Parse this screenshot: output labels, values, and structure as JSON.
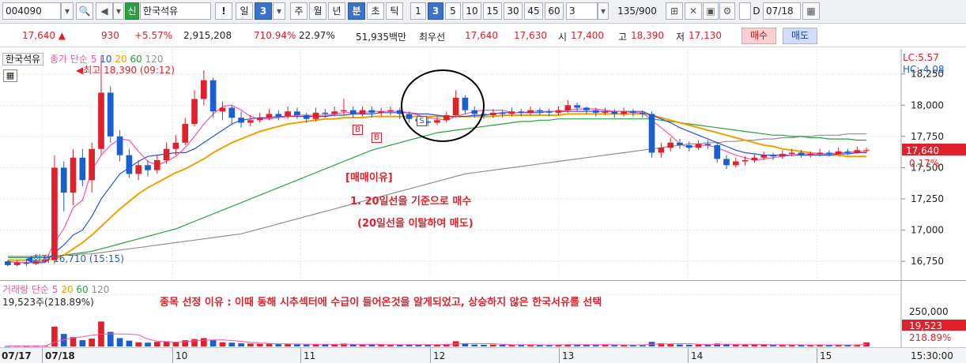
{
  "toolbar": {
    "stock_code": "004090",
    "stock_name_tag": "신",
    "stock_name": "한국석유",
    "period_day": "일",
    "period_day_count": "3",
    "period_week": "주",
    "period_month": "월",
    "period_year": "년",
    "period_minute": "분",
    "period_second": "초",
    "period_tick": "틱",
    "interval_options": [
      "1",
      "3",
      "5",
      "10",
      "15",
      "30",
      "45",
      "60"
    ],
    "selected_interval": "3",
    "interval_field": "3",
    "bar_count": "135/900",
    "date_checkbox_label": "D",
    "date_value": "07/18"
  },
  "quote": {
    "price": "17,640 ▲",
    "change": "930",
    "change_pct": "+5.57%",
    "volume": "2,915,208",
    "volume_ratio": "710.94%",
    "turnover": "22.97%",
    "trade_value": "51,935백만",
    "best_label": "최우선",
    "best_ask": "17,640",
    "best_bid": "17,630",
    "open_label": "시",
    "open": "17,400",
    "high_label": "고",
    "high": "18,390",
    "low_label": "저",
    "low": "17,130",
    "buy_button": "매수",
    "sell_button": "매도"
  },
  "price_legend": {
    "name": "한국석유",
    "ma_prefix": "종가 단순",
    "ma_periods": [
      "5",
      "10",
      "20",
      "60",
      "120"
    ],
    "high_marker": "최고 18,390 (09:12)",
    "low_marker": "최저 16,710 (15:15)"
  },
  "volume_legend": {
    "title": "거래량 단순",
    "ma_periods": [
      "5",
      "20",
      "60",
      "120"
    ],
    "current": "19,523주(218.89%)"
  },
  "right_axis": {
    "lc": "LC:5.57",
    "hc": "HC:-4.08",
    "price_ticks": [
      "18,250",
      "18,000",
      "17,750",
      "17,500",
      "17,250",
      "17,000",
      "16,750"
    ],
    "current_price": "17,640",
    "current_pct": "0.17%",
    "volume_ticks": [
      "250,000"
    ],
    "current_volume": "19,523",
    "current_volume_pct": "218.89%",
    "time_label": "15:30:00"
  },
  "x_axis": {
    "labels": [
      "07/17",
      "07/18",
      "10",
      "11",
      "12",
      "13",
      "14",
      "15"
    ]
  },
  "annotations": {
    "reason_title": "[매매이유]",
    "reason_1": "1. 20일선을 기준으로 매수",
    "reason_2": "(20일선을 이탈하여 매도)",
    "selection_reason": "종목 선정 이유 : 이때 동해 시추섹터에 수급이 들어온것을 알게되었고, 상승하지 않은 한국서유를 선택",
    "signal_b1": "B",
    "signal_b2": "B",
    "signal_s": "S"
  },
  "colors": {
    "up": "#e0202a",
    "down": "#1a5fd0",
    "ma5": "#ff4fae",
    "ma10": "#2a4fe0",
    "ma20": "#f0a000",
    "ma60": "#2aa040",
    "ma120": "#909090"
  },
  "chart_data": {
    "type": "candlestick",
    "ylim": [
      16650,
      18400
    ],
    "high": 18390,
    "low": 16710,
    "candles": [
      [
        16750,
        16720,
        16760,
        16710
      ],
      [
        16720,
        16740,
        16760,
        16710
      ],
      [
        16740,
        16730,
        16770,
        16710
      ],
      [
        16730,
        16750,
        16760,
        16720
      ],
      [
        16750,
        16760,
        16790,
        16740
      ],
      [
        16760,
        17500,
        17600,
        16730
      ],
      [
        17500,
        17300,
        17550,
        17150
      ],
      [
        17300,
        17580,
        17650,
        17200
      ],
      [
        17580,
        17400,
        17650,
        17350
      ],
      [
        17400,
        17650,
        17700,
        17300
      ],
      [
        17650,
        18100,
        18390,
        17600
      ],
      [
        18100,
        17750,
        18150,
        17700
      ],
      [
        17750,
        17600,
        17800,
        17550
      ],
      [
        17600,
        17450,
        17650,
        17420
      ],
      [
        17450,
        17520,
        17560,
        17400
      ],
      [
        17520,
        17480,
        17560,
        17430
      ],
      [
        17480,
        17560,
        17600,
        17450
      ],
      [
        17560,
        17650,
        17700,
        17530
      ],
      [
        17650,
        17700,
        17760,
        17600
      ],
      [
        17700,
        17850,
        17900,
        17680
      ],
      [
        17850,
        18050,
        18120,
        17830
      ],
      [
        18050,
        18200,
        18280,
        18000
      ],
      [
        18200,
        17950,
        18220,
        17900
      ],
      [
        17950,
        17980,
        18030,
        17880
      ],
      [
        17980,
        17900,
        18000,
        17850
      ],
      [
        17900,
        17860,
        17950,
        17820
      ],
      [
        17860,
        17880,
        17920,
        17830
      ],
      [
        17880,
        17900,
        17940,
        17860
      ],
      [
        17900,
        17930,
        17970,
        17880
      ],
      [
        17930,
        17910,
        17960,
        17880
      ],
      [
        17910,
        17950,
        17990,
        17890
      ],
      [
        17950,
        17920,
        17980,
        17890
      ],
      [
        17920,
        17890,
        17940,
        17860
      ],
      [
        17890,
        17940,
        17980,
        17870
      ],
      [
        17940,
        17930,
        17970,
        17900
      ],
      [
        17930,
        17950,
        17990,
        17910
      ],
      [
        17950,
        17960,
        18050,
        17920
      ],
      [
        17960,
        17930,
        17990,
        17900
      ],
      [
        17930,
        17960,
        17990,
        17910
      ],
      [
        17960,
        17940,
        17990,
        17900
      ],
      [
        17940,
        17950,
        17980,
        17910
      ],
      [
        17950,
        17960,
        17990,
        17920
      ],
      [
        17960,
        17930,
        17980,
        17890
      ],
      [
        17930,
        17890,
        17950,
        17860
      ],
      [
        17890,
        17870,
        17910,
        17840
      ],
      [
        17870,
        17860,
        17900,
        17830
      ],
      [
        17860,
        17880,
        17910,
        17840
      ],
      [
        17880,
        17920,
        17950,
        17860
      ],
      [
        17920,
        18060,
        18120,
        17900
      ],
      [
        18060,
        17960,
        18080,
        17930
      ],
      [
        17960,
        17930,
        17990,
        17900
      ],
      [
        17930,
        17920,
        17960,
        17890
      ],
      [
        17920,
        17940,
        17970,
        17900
      ],
      [
        17940,
        17930,
        17960,
        17900
      ],
      [
        17930,
        17950,
        17980,
        17910
      ],
      [
        17950,
        17940,
        17970,
        17910
      ],
      [
        17940,
        17960,
        17990,
        17920
      ],
      [
        17960,
        17950,
        17980,
        17920
      ],
      [
        17950,
        17940,
        17970,
        17910
      ],
      [
        17940,
        17960,
        17990,
        17920
      ],
      [
        17960,
        18000,
        18040,
        17940
      ],
      [
        18000,
        17980,
        18020,
        17950
      ],
      [
        17980,
        17960,
        17990,
        17930
      ],
      [
        17960,
        17940,
        17980,
        17910
      ],
      [
        17940,
        17950,
        17980,
        17920
      ],
      [
        17950,
        17930,
        17970,
        17900
      ],
      [
        17930,
        17950,
        17980,
        17910
      ],
      [
        17950,
        17940,
        17970,
        17910
      ],
      [
        17940,
        17930,
        17960,
        17900
      ],
      [
        17930,
        17620,
        17950,
        17580
      ],
      [
        17620,
        17660,
        17700,
        17580
      ],
      [
        17660,
        17700,
        17740,
        17630
      ],
      [
        17700,
        17680,
        17730,
        17650
      ],
      [
        17680,
        17660,
        17710,
        17630
      ],
      [
        17660,
        17690,
        17720,
        17640
      ],
      [
        17690,
        17680,
        17720,
        17650
      ],
      [
        17680,
        17570,
        17700,
        17540
      ],
      [
        17570,
        17520,
        17600,
        17490
      ],
      [
        17520,
        17550,
        17580,
        17500
      ],
      [
        17550,
        17560,
        17590,
        17520
      ],
      [
        17560,
        17580,
        17610,
        17540
      ],
      [
        17580,
        17600,
        17630,
        17560
      ],
      [
        17600,
        17590,
        17620,
        17560
      ],
      [
        17590,
        17610,
        17640,
        17570
      ],
      [
        17610,
        17620,
        17650,
        17590
      ],
      [
        17620,
        17600,
        17640,
        17580
      ],
      [
        17600,
        17610,
        17630,
        17580
      ],
      [
        17610,
        17620,
        17650,
        17590
      ],
      [
        17620,
        17610,
        17640,
        17590
      ],
      [
        17610,
        17630,
        17660,
        17600
      ],
      [
        17630,
        17620,
        17650,
        17600
      ],
      [
        17620,
        17640,
        17670,
        17610
      ],
      [
        17640,
        17640,
        17660,
        17620
      ]
    ],
    "moving_averages": [
      {
        "name": "5",
        "color": "#ff4fae",
        "values": [
          16750,
          16740,
          16740,
          16740,
          16750,
          16900,
          17010,
          17180,
          17240,
          17480,
          17600,
          17680,
          17730,
          17720,
          17630,
          17550,
          17520,
          17550,
          17590,
          17660,
          17750,
          17850,
          17930,
          17990,
          18000,
          17960,
          17910,
          17890,
          17890,
          17900,
          17910,
          17920,
          17920,
          17920,
          17920,
          17930,
          17940,
          17940,
          17940,
          17950,
          17950,
          17950,
          17950,
          17940,
          17920,
          17900,
          17890,
          17880,
          17910,
          17930,
          17950,
          17960,
          17960,
          17960,
          17940,
          17940,
          17950,
          17950,
          17950,
          17950,
          17960,
          17970,
          17970,
          17970,
          17960,
          17950,
          17950,
          17940,
          17940,
          17880,
          17820,
          17760,
          17690,
          17660,
          17680,
          17680,
          17660,
          17630,
          17600,
          17580,
          17560,
          17570,
          17580,
          17590,
          17600,
          17610,
          17610,
          17610,
          17610,
          17620,
          17620,
          17630,
          17630
        ]
      },
      {
        "name": "10",
        "color": "#2a4fe0",
        "values": [
          16750,
          16740,
          16740,
          16740,
          16740,
          16820,
          16880,
          16960,
          17000,
          17110,
          17250,
          17350,
          17450,
          17500,
          17550,
          17590,
          17600,
          17610,
          17620,
          17620,
          17650,
          17700,
          17750,
          17800,
          17850,
          17880,
          17890,
          17900,
          17900,
          17910,
          17910,
          17910,
          17910,
          17910,
          17910,
          17920,
          17920,
          17930,
          17930,
          17930,
          17940,
          17940,
          17940,
          17940,
          17930,
          17930,
          17920,
          17910,
          17910,
          17910,
          17920,
          17920,
          17930,
          17940,
          17940,
          17940,
          17940,
          17940,
          17950,
          17950,
          17950,
          17950,
          17950,
          17950,
          17950,
          17950,
          17950,
          17950,
          17950,
          17920,
          17890,
          17860,
          17820,
          17790,
          17760,
          17730,
          17700,
          17670,
          17640,
          17620,
          17610,
          17600,
          17600,
          17600,
          17600,
          17600,
          17600,
          17600,
          17600,
          17610,
          17610,
          17620,
          17620
        ]
      },
      {
        "name": "20",
        "color": "#f0a000",
        "values": [
          16760,
          16760,
          16760,
          16760,
          16760,
          16770,
          16800,
          16850,
          16900,
          16960,
          17030,
          17100,
          17170,
          17230,
          17290,
          17340,
          17380,
          17420,
          17460,
          17490,
          17530,
          17570,
          17620,
          17660,
          17700,
          17730,
          17760,
          17790,
          17810,
          17830,
          17850,
          17860,
          17870,
          17880,
          17890,
          17890,
          17900,
          17900,
          17900,
          17910,
          17910,
          17910,
          17910,
          17910,
          17910,
          17910,
          17910,
          17910,
          17910,
          17910,
          17910,
          17910,
          17910,
          17920,
          17920,
          17920,
          17920,
          17920,
          17920,
          17920,
          17930,
          17930,
          17930,
          17930,
          17930,
          17930,
          17930,
          17930,
          17930,
          17920,
          17900,
          17880,
          17860,
          17840,
          17820,
          17800,
          17780,
          17760,
          17740,
          17720,
          17700,
          17680,
          17670,
          17650,
          17640,
          17630,
          17620,
          17610,
          17600,
          17600,
          17590,
          17590,
          17590
        ]
      },
      {
        "name": "60",
        "color": "#2aa040",
        "values": [
          16780,
          16780,
          16780,
          16780,
          16780,
          16790,
          16800,
          16810,
          16820,
          16830,
          16850,
          16870,
          16890,
          16910,
          16930,
          16950,
          16970,
          16990,
          17010,
          17040,
          17070,
          17100,
          17130,
          17160,
          17190,
          17220,
          17250,
          17280,
          17310,
          17340,
          17370,
          17400,
          17430,
          17460,
          17490,
          17520,
          17550,
          17580,
          17610,
          17640,
          17660,
          17680,
          17700,
          17720,
          17740,
          17760,
          17780,
          17790,
          17800,
          17810,
          17820,
          17830,
          17840,
          17850,
          17860,
          17870,
          17870,
          17880,
          17880,
          17890,
          17890,
          17890,
          17890,
          17890,
          17890,
          17890,
          17890,
          17890,
          17890,
          17890,
          17880,
          17870,
          17860,
          17850,
          17840,
          17830,
          17820,
          17810,
          17800,
          17790,
          17780,
          17770,
          17760,
          17760,
          17750,
          17750,
          17740,
          17740,
          17730,
          17730,
          17730,
          17720,
          17720
        ]
      },
      {
        "name": "120",
        "color": "#909090",
        "values": [
          16790,
          16790,
          16790,
          16790,
          16790,
          16790,
          16800,
          16800,
          16810,
          16810,
          16820,
          16830,
          16840,
          16850,
          16860,
          16870,
          16880,
          16890,
          16900,
          16910,
          16920,
          16930,
          16940,
          16950,
          16960,
          16970,
          16990,
          17010,
          17030,
          17050,
          17070,
          17090,
          17110,
          17130,
          17150,
          17170,
          17190,
          17210,
          17230,
          17250,
          17270,
          17290,
          17310,
          17330,
          17350,
          17370,
          17390,
          17410,
          17430,
          17450,
          17460,
          17470,
          17480,
          17490,
          17500,
          17510,
          17520,
          17530,
          17540,
          17550,
          17560,
          17570,
          17580,
          17590,
          17600,
          17610,
          17620,
          17630,
          17640,
          17650,
          17660,
          17670,
          17680,
          17690,
          17690,
          17700,
          17700,
          17710,
          17710,
          17720,
          17720,
          17730,
          17730,
          17740,
          17740,
          17750,
          17750,
          17760,
          17760,
          17760,
          17770,
          17770,
          17770
        ]
      }
    ],
    "volume": [
      2000,
      2500,
      1800,
      2200,
      3000,
      95000,
      60000,
      45000,
      30000,
      38000,
      120000,
      70000,
      40000,
      28000,
      20000,
      18000,
      22000,
      25000,
      20000,
      30000,
      35000,
      40000,
      30000,
      20000,
      18000,
      15000,
      14000,
      12000,
      13000,
      11000,
      12000,
      10000,
      9000,
      11000,
      9000,
      10000,
      14000,
      9000,
      8000,
      9000,
      8000,
      9000,
      8000,
      10000,
      9000,
      8000,
      9000,
      11000,
      25000,
      15000,
      9000,
      8000,
      9000,
      8000,
      7000,
      8000,
      7000,
      8000,
      7000,
      8000,
      10000,
      9000,
      8000,
      7000,
      8000,
      7000,
      8000,
      7000,
      7000,
      22000,
      15000,
      12000,
      9000,
      8000,
      9000,
      8000,
      14000,
      12000,
      9000,
      8000,
      9000,
      8000,
      7000,
      8000,
      7000,
      8000,
      7000,
      8000,
      7000,
      8000,
      7000,
      8000,
      19523
    ],
    "volume_ylim": [
      0,
      300000
    ]
  }
}
